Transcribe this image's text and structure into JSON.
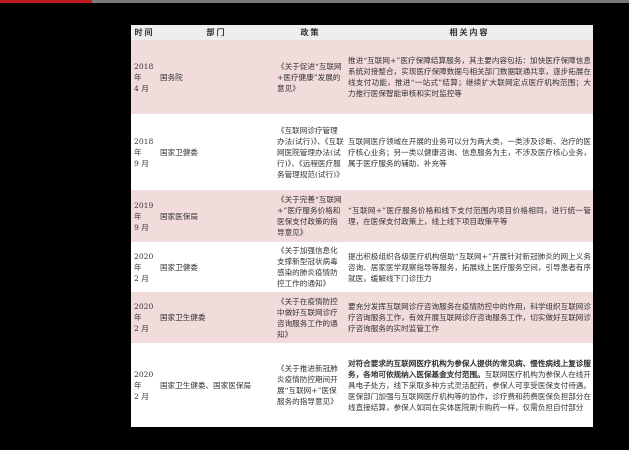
{
  "headers": {
    "time": "时间",
    "dept": "部门",
    "policy": "政策",
    "content": "相关内容"
  },
  "rows": [
    {
      "time": "2018 年\n4 月",
      "dept": "国务院",
      "policy": "《关于促进“互联网+医疗健康”发展的意见》",
      "content": "推进“互联网+”医疗保障结算服务，其主要内容包括：加快医疗保障信息系统对接整合，实现医疗保障数据与相关部门数据联通共享，逐步拓展在线支付功能，推进“一站式”结算；继续扩大联网定点医疗机构范围；大力推行医保智能审核和实时监控等",
      "bold": "",
      "shaded": true
    },
    {
      "time": "2018 年\n9 月",
      "dept": "国家卫健委",
      "policy": "《互联网诊疗管理办法(试行)》、《互联网医院管理办法(试行)》、《远程医疗服务管理规范(试行)》",
      "content": "互联网医疗领域在开展的业务可以分为两大类，一类涉及诊断、治疗的医疗核心业务；另一类以健康咨询、信息服务为主，不涉及医疗核心业务，属于医疗服务的辅助、补充等",
      "bold": "",
      "shaded": false
    },
    {
      "time": "2019 年\n9 月",
      "dept": "国家医保局",
      "policy": "《关于完善“互联网+”医疗服务价格和医保支付政策的指导意见》",
      "content": "“互联网+”医疗服务价格和线下支付范围内项目价格相同，进行统一管理，在医保支付政策上，线上线下项目政策平等",
      "bold": "",
      "shaded": true
    },
    {
      "time": "2020 年\n2 月",
      "dept": "国家卫健委",
      "policy": "《关于加强信息化支撑新型冠状病毒感染的肺炎疫情防控工作的通知》",
      "content": "提出积极组织各级医疗机构借助“互联网+”开展针对新冠肺炎的网上义务咨询、居家医学观察指导等服务，拓展线上医疗服务空间，引导患者有序就医，缓解线下门诊压力",
      "bold": "",
      "shaded": false
    },
    {
      "time": "2020 年\n2 月",
      "dept": "国家卫生健委",
      "policy": "《关于在疫情防控中做好互联网诊疗咨询服务工作的通知》",
      "content": "要充分发挥互联网诊疗咨询服务在疫情防控中的作用，科学组织互联网诊疗咨询服务工作，有效开展互联网诊疗咨询服务工作，切实做好互联网诊疗咨询服务的实时监管工作",
      "bold": "",
      "shaded": true
    },
    {
      "time": "2020 年\n2 月",
      "dept": "国家卫生健委、国家医保局",
      "policy": "《关于推进新冠肺炎疫情防控期间开展“互联网+”医保服务的指导意见》",
      "content": "互联网医疗机构为参保人在线开具电子处方，线下采取多种方式灵活配药，参保人可享受医保支付待遇。医保部门加强与互联网医疗机构等的协作，诊疗费和药费医保负担部分在线直接结算，参保人如同在实体医院刷卡购药一样，仅需负担自付部分",
      "bold": "对符合要求的互联网医疗机构为参保人提供的常见病、慢性病线上复诊服务，各地可依规纳入医保基金支付范围。",
      "shaded": false
    }
  ]
}
